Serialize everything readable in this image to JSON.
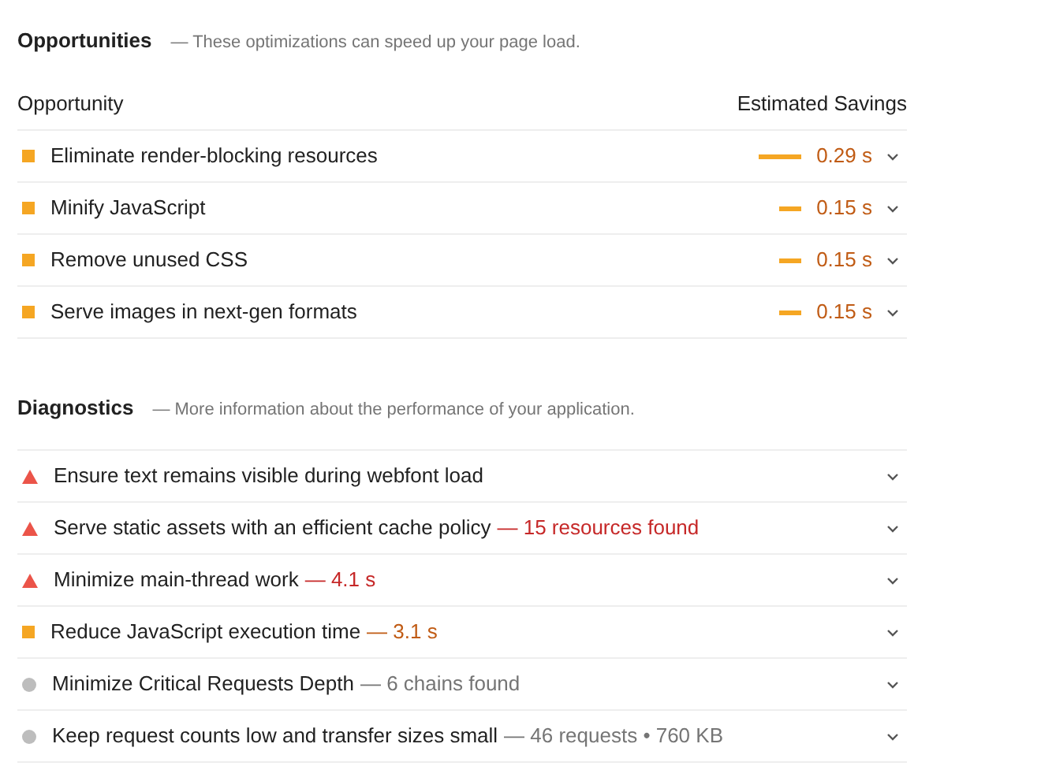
{
  "opportunities": {
    "title": "Opportunities",
    "description": "— These optimizations can speed up your page load.",
    "columns": [
      "Opportunity",
      "Estimated Savings"
    ],
    "rows": [
      {
        "kind": "average",
        "label": "Eliminate render-blocking resources",
        "bar": {
          "kind": "wide"
        },
        "savings": "0.29 s"
      },
      {
        "kind": "average",
        "label": "Minify JavaScript",
        "bar": {
          "kind": "narrow"
        },
        "savings": "0.15 s"
      },
      {
        "kind": "average",
        "label": "Remove unused CSS",
        "bar": {
          "kind": "narrow"
        },
        "savings": "0.15 s"
      },
      {
        "kind": "average",
        "label": "Serve images in next-gen formats",
        "bar": {
          "kind": "narrow"
        },
        "savings": "0.15 s"
      }
    ]
  },
  "diagnostics": {
    "title": "Diagnostics",
    "description": "— More information about the performance of your application.",
    "rows": [
      {
        "kind": "fail",
        "label": "Ensure text remains visible during webfont load"
      },
      {
        "kind": "fail",
        "label": "Serve static assets with an efficient cache policy",
        "detail": "— 15 resources found"
      },
      {
        "kind": "fail",
        "label": "Minimize main-thread work",
        "detail": "— 4.1 s"
      },
      {
        "kind": "average",
        "label": "Reduce JavaScript execution time",
        "detail": "— 3.1 s"
      },
      {
        "kind": "info",
        "label": "Minimize Critical Requests Depth",
        "detail": "— 6 chains found"
      },
      {
        "kind": "info",
        "label": "Keep request counts low and transfer sizes small",
        "detail": "— 46 requests • 760 KB"
      }
    ]
  }
}
